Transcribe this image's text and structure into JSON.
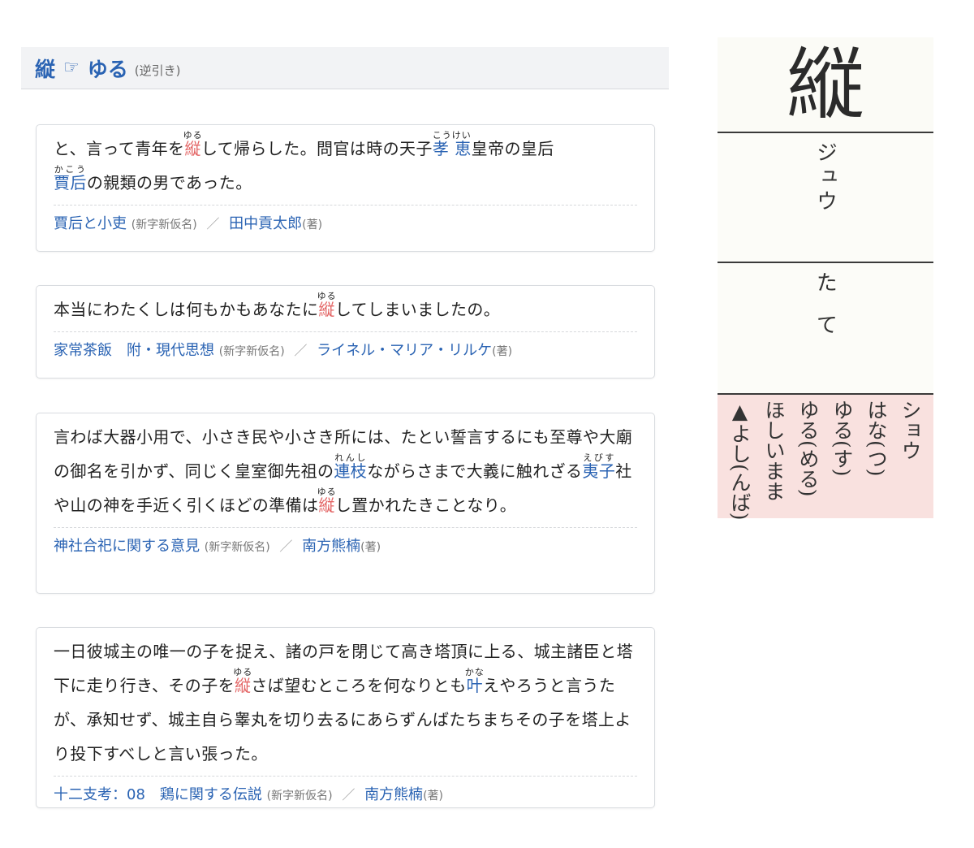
{
  "header": {
    "kanji": "縦",
    "arrow_icon": "☞",
    "reading": "ゆる",
    "note": "(逆引き)"
  },
  "cards": [
    {
      "t": [
        "と、言って青年を",
        "縦",
        "ゆる",
        "して帰らした。問官は時の天子",
        "孝 恵",
        "こうけい",
        "皇帝の皇后",
        "賈后",
        "かこう",
        "の親類の男であった。"
      ],
      "source": {
        "title": "賈后と小吏",
        "note": "(新字新仮名)",
        "sep": "／",
        "author": "田中貢太郎",
        "role": "(著)"
      }
    },
    {
      "t": [
        "本当にわたくしは何もかもあなたに",
        "縦",
        "ゆる",
        "してしまいましたの。"
      ],
      "source": {
        "title": "家常茶飯　附・現代思想",
        "note": "(新字新仮名)",
        "sep": "／",
        "author": "ライネル・マリア・リルケ",
        "role": "(著)"
      }
    },
    {
      "t": [
        "言わば大器小用で、小さき民や小さき所には、たとい誓言するにも至尊や大廟の御名を引かず、同じく皇室御先祖の",
        "連枝",
        "れんし",
        "ながらさまで大義に触れざる",
        "夷子",
        "えびす",
        "社や山の神を手近く引くほどの準備は",
        "縦",
        "ゆる",
        "し置かれたきことなり。"
      ],
      "source": {
        "title": "神社合祀に関する意見",
        "note": "(新字新仮名)",
        "sep": "／",
        "author": "南方熊楠",
        "role": "(著)"
      }
    },
    {
      "t": [
        "一日彼城主の唯一の子を捉え、諸の戸を閉じて高き塔頂に上る、城主諸臣と塔下に走り行き、その子を",
        "縦",
        "ゆる",
        "さば望むところを何なりとも",
        "叶",
        "かな",
        "えやろうと言うたが、承知せず、城主自ら睾丸を切り去るにあらずんばたちまちその子を塔上より投下すべしと言い張った。"
      ],
      "source": {
        "title": "十二支考：08　鶏に関する伝説",
        "note": "(新字新仮名)",
        "sep": "／",
        "author": "南方熊楠",
        "role": "(著)"
      }
    }
  ],
  "dictionary": {
    "kanji": "縦",
    "on_reading": "ジュウ",
    "kun_reading": "たて",
    "other_readings": [
      "ショウ",
      "はな(つ)",
      "ゆる(す)",
      "ゆる(める)",
      "ほしいまま",
      "▲よし(んば)"
    ]
  }
}
